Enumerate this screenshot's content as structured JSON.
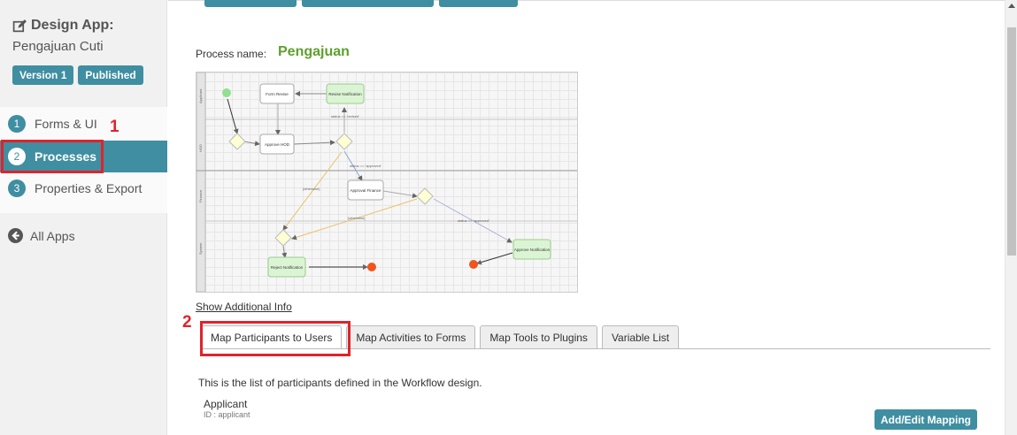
{
  "sidebar": {
    "app_title": "Design App:",
    "app_name": "Pengajuan Cuti",
    "version_badge": "Version 1",
    "published_badge": "Published",
    "menu": [
      {
        "num": "1",
        "label": "Forms & UI"
      },
      {
        "num": "2",
        "label": "Processes"
      },
      {
        "num": "3",
        "label": "Properties & Export"
      }
    ],
    "all_apps": "All Apps"
  },
  "annotations": {
    "one": "1",
    "two": "2"
  },
  "main": {
    "process_label": "Process name:",
    "process_name": "Pengajuan",
    "show_info": "Show Additional Info",
    "tabs": [
      {
        "label": "Map Participants to Users"
      },
      {
        "label": "Map Activities to Forms"
      },
      {
        "label": "Map Tools to Plugins"
      },
      {
        "label": "Variable List"
      }
    ],
    "description": "This is the list of participants defined in the Workflow design.",
    "participant": {
      "name": "Applicant",
      "id": "ID : applicant"
    },
    "map_button": "Add/Edit Mapping"
  },
  "diagram": {
    "lanes": [
      "Applicant",
      "HOD",
      "Finance",
      "System"
    ],
    "nodes": [
      "Form Revise",
      "Revise Notification",
      "Approve HOD",
      "Approval Finance",
      "Approve Notification",
      "Reject Notification"
    ],
    "edge_labels": [
      "status == 'revised'",
      "status == 'approved'",
      "[otherwise]",
      "[otherwise]",
      "status == 'approved'"
    ]
  },
  "colors": {
    "accent": "#3f8ea2",
    "process_name": "#5ea02e",
    "annotation": "#e0232b"
  }
}
